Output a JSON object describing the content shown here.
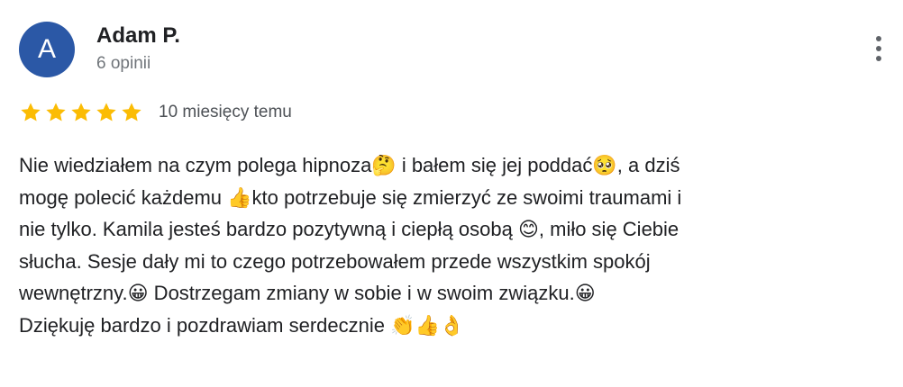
{
  "reviewer": {
    "avatar_letter": "A",
    "name": "Adam P.",
    "review_count": "6 opinii"
  },
  "menu": {
    "icon": "more-vertical-icon"
  },
  "rating": {
    "stars": 5,
    "max_stars": 5,
    "date": "10 miesięcy temu"
  },
  "review": {
    "text": "Nie wiedziałem na czym polega hipnoza🤔 i bałem się jej poddać🥺, a dziś\nmogę polecić każdemu 👍kto potrzebuje się zmierzyć ze swoimi traumami i\nnie tylko. Kamila jesteś bardzo pozytywną i ciepłą osobą 😊, miło się Ciebie\nsłucha. Sesje dały mi to czego potrzebowałem przede wszystkim spokój\nwewnętrzny.😀 Dostrzegam zmiany w sobie i w swoim związku.😀\nDziękuję bardzo i pozdrawiam serdecznie 👏👍👌"
  },
  "colors": {
    "avatar_bg": "#2b58a6",
    "star": "#fbbc04",
    "text": "#202124",
    "secondary_text": "#70757a"
  }
}
